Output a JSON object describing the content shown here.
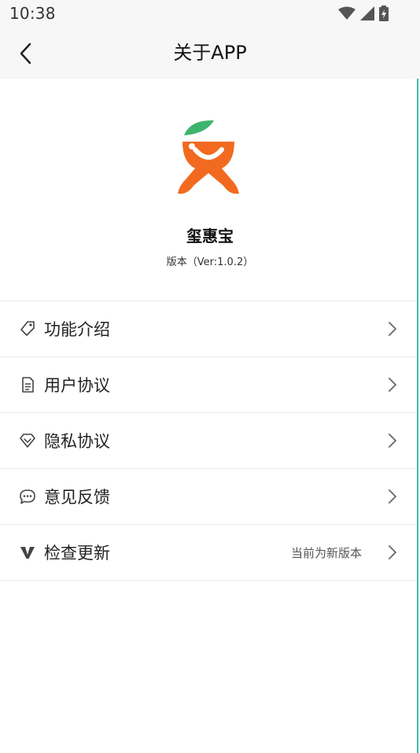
{
  "status_bar": {
    "time": "10:38"
  },
  "nav": {
    "title": "关于APP"
  },
  "app": {
    "name": "玺惠宝",
    "version": "版本（Ver:1.0.2）"
  },
  "colors": {
    "brand_orange": "#f26a1f",
    "leaf_green": "#3db46d",
    "divider": "#ececec"
  },
  "menu": {
    "items": [
      {
        "label": "功能介绍",
        "icon": "tag-icon"
      },
      {
        "label": "用户协议",
        "icon": "document-icon"
      },
      {
        "label": "隐私协议",
        "icon": "diamond-icon"
      },
      {
        "label": "意见反馈",
        "icon": "chat-bubble-icon"
      },
      {
        "label": "检查更新",
        "icon": "v-letter-icon",
        "extra": "当前为新版本"
      }
    ]
  }
}
